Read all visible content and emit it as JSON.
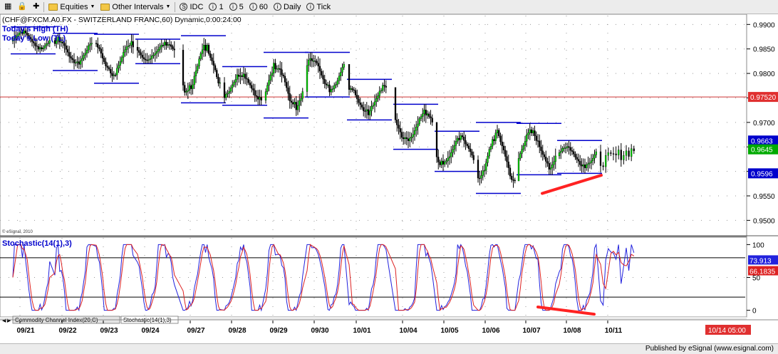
{
  "toolbar": {
    "items": [
      {
        "icon": "grid-icon",
        "label": ""
      },
      {
        "icon": "lock-icon",
        "label": ""
      },
      {
        "icon": "plus-icon",
        "label": ""
      },
      {
        "icon": "folder-icon",
        "label": "Equities",
        "dropdown": true
      },
      {
        "icon": "folder-icon",
        "label": "Other Intervals",
        "dropdown": true
      },
      {
        "icon": "circle-s-icon",
        "label": "IDC"
      },
      {
        "icon": "circle-i-icon",
        "label": "1"
      },
      {
        "icon": "circle-i-icon",
        "label": "5"
      },
      {
        "icon": "circle-i-icon",
        "label": "60"
      },
      {
        "icon": "circle-i-icon",
        "label": "Daily"
      },
      {
        "icon": "circle-i-icon",
        "label": "Tick"
      }
    ]
  },
  "chart_data": [
    {
      "type": "candlestick",
      "title": "(CHF@FXCM.A0.FX - SWITZERLAND FRANC,60) Dynamic,0:00:24:00",
      "legend": [
        "Today's High (TH)",
        "Today's Low (TL)"
      ],
      "watermark": "© eSignal, 2010",
      "yticks": [
        0.95,
        0.955,
        0.96,
        0.965,
        0.97,
        0.975,
        0.98,
        0.985,
        0.99
      ],
      "ytick_labels": [
        "0.9500",
        "0.9550",
        "0.9600",
        "0.9650",
        "0.9700",
        "0.9750",
        "0.9800",
        "0.9850",
        "0.9900"
      ],
      "ylim": [
        0.947,
        0.9915
      ],
      "grid": true,
      "ref_line": {
        "value": 0.9752,
        "label": "0.97520"
      },
      "price_badges": [
        {
          "value": 0.9663,
          "label": "0.9663",
          "color": "#0000cc"
        },
        {
          "value": 0.9645,
          "label": "0.9645",
          "color": "#00aa00"
        },
        {
          "value": 0.9596,
          "label": "0.9596",
          "color": "#0000cc"
        }
      ],
      "daily_high_low": [
        {
          "date": "09/21",
          "high": 0.9895,
          "low": 0.984
        },
        {
          "date": "09/22",
          "high": 0.9882,
          "low": 0.9806
        },
        {
          "date": "09/23",
          "high": 0.988,
          "low": 0.978
        },
        {
          "date": "09/24",
          "high": 0.987,
          "low": 0.982
        },
        {
          "date": "09/27",
          "high": 0.9877,
          "low": 0.974
        },
        {
          "date": "09/28",
          "high": 0.9814,
          "low": 0.9735
        },
        {
          "date": "09/29",
          "high": 0.9843,
          "low": 0.9709
        },
        {
          "date": "09/30",
          "high": 0.9843,
          "low": 0.9752
        },
        {
          "date": "10/01",
          "high": 0.9788,
          "low": 0.9705
        },
        {
          "date": "10/04",
          "high": 0.9737,
          "low": 0.9645
        },
        {
          "date": "10/05",
          "high": 0.9682,
          "low": 0.96
        },
        {
          "date": "10/06",
          "high": 0.97,
          "low": 0.9555
        },
        {
          "date": "10/07",
          "high": 0.9698,
          "low": 0.9593
        },
        {
          "date": "10/08",
          "high": 0.9663,
          "low": 0.9596
        }
      ],
      "trendline": [
        {
          "date": "10/07",
          "value": 0.9555
        },
        {
          "date": "10/08",
          "value": 0.9595
        }
      ]
    },
    {
      "type": "line",
      "title": "Stochastic(14(1),3)",
      "yticks": [
        0,
        50,
        100
      ],
      "ytick_labels": [
        "0",
        "50",
        "100"
      ],
      "ylim": [
        -8,
        108
      ],
      "levels": [
        20,
        80
      ],
      "series": [
        {
          "color": "#2222dd",
          "last": 73.913,
          "label": "73.913"
        },
        {
          "color": "#dd2222",
          "last": 66.1835,
          "label": "66.1835"
        }
      ],
      "trendline": [
        {
          "date": "10/07",
          "value": 5
        },
        {
          "date": "10/08",
          "value": -6
        }
      ]
    }
  ],
  "x_axis": {
    "labels": [
      "09/21",
      "09/22",
      "09/23",
      "09/24",
      "09/27",
      "09/28",
      "09/29",
      "09/30",
      "10/01",
      "10/04",
      "10/05",
      "10/06",
      "10/07",
      "10/08",
      "10/11"
    ],
    "time_badge": "10/14 05:00"
  },
  "tabs": [
    "Commodity Channel Index(20,C)",
    "Stochastic(14(1),3)"
  ],
  "footer": {
    "text": "Published by eSignal (www.esignal.com)"
  }
}
